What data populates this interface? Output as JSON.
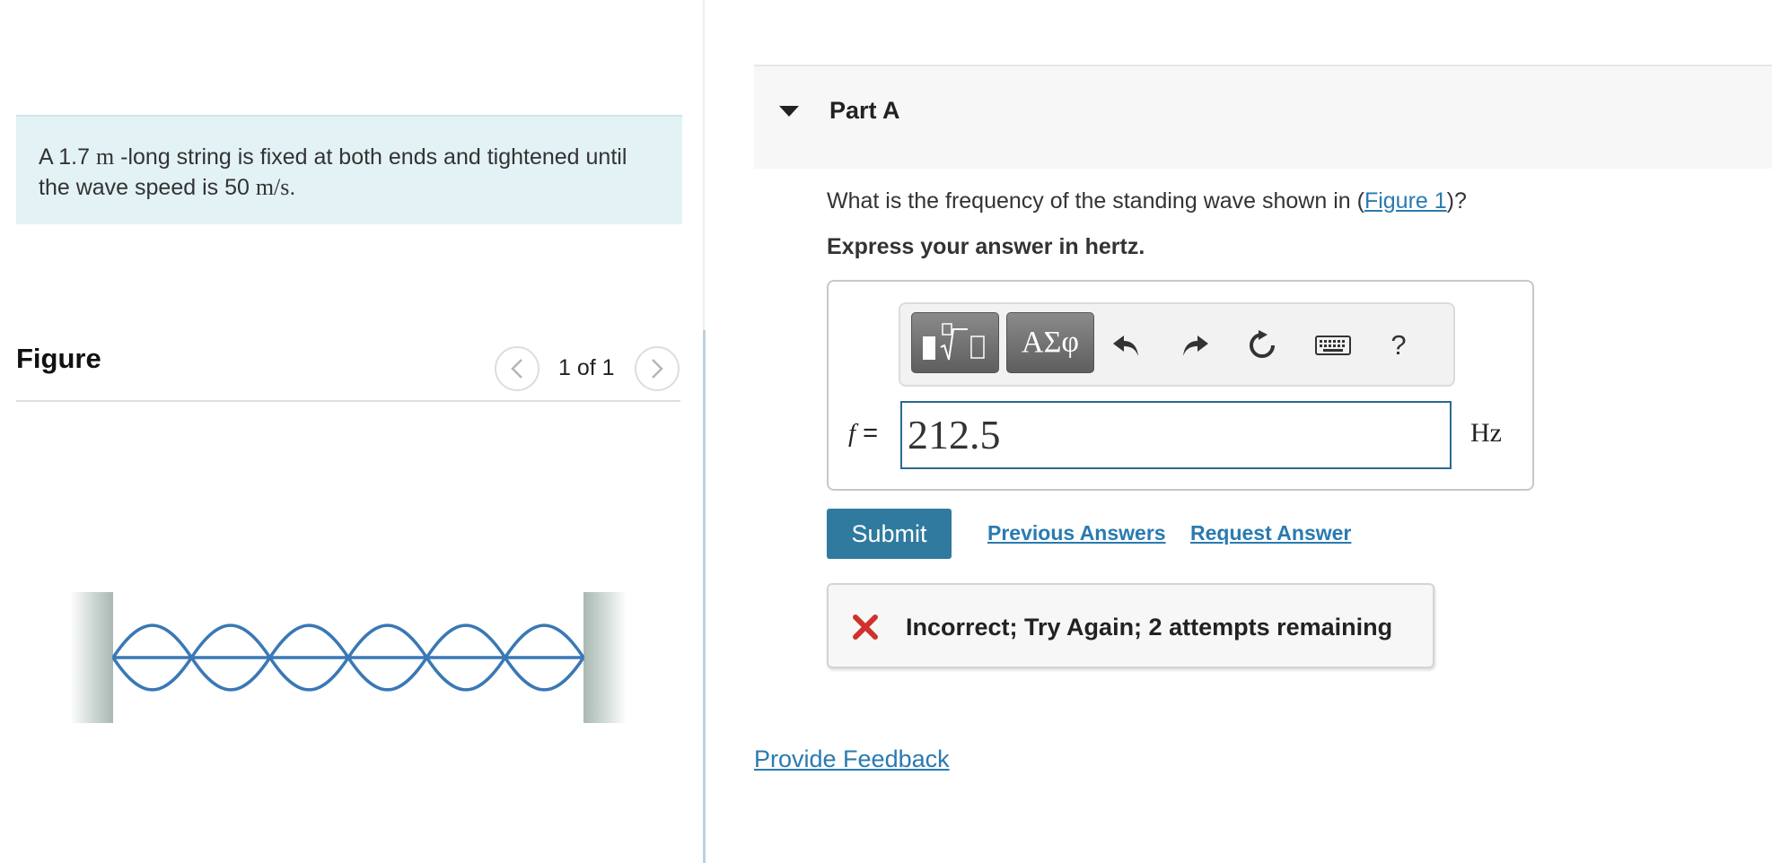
{
  "problem": {
    "text_part1": "A 1.7 ",
    "unit_m": "m",
    "text_part2": " -long string is fixed at both ends and tightened until the wave speed is 50 ",
    "unit_speed": "m/s",
    "text_part3": "."
  },
  "figure": {
    "title": "Figure",
    "page_count": "1 of 1",
    "prev_icon": "chevron-left-icon",
    "next_icon": "chevron-right-icon",
    "standing_wave_loops": 6
  },
  "part": {
    "title": "Part A",
    "question_prefix": "What is the frequency of the standing wave shown in (",
    "question_link": "Figure 1",
    "question_suffix": ")?",
    "instruction": "Express your answer in hertz."
  },
  "toolbar": {
    "greek_label": "ΑΣφ",
    "help_label": "?",
    "icons": [
      "templates-icon",
      "greek-letters-icon",
      "undo-icon",
      "redo-icon",
      "reset-icon",
      "keyboard-icon",
      "help-icon"
    ]
  },
  "answer": {
    "variable": "f",
    "equals": "=",
    "value": "212.5",
    "unit": "Hz"
  },
  "actions": {
    "submit_label": "Submit",
    "previous_answers_label": "Previous Answers",
    "request_answer_label": "Request Answer"
  },
  "feedback": {
    "message": "Incorrect; Try Again; 2 attempts remaining",
    "status_color": "#d0312d"
  },
  "footer": {
    "provide_feedback_label": "Provide Feedback"
  },
  "colors": {
    "accent": "#2f7a9e",
    "link": "#2a7ab0",
    "problem_bg": "#e3f2f5",
    "wave": "#3a78b5"
  }
}
